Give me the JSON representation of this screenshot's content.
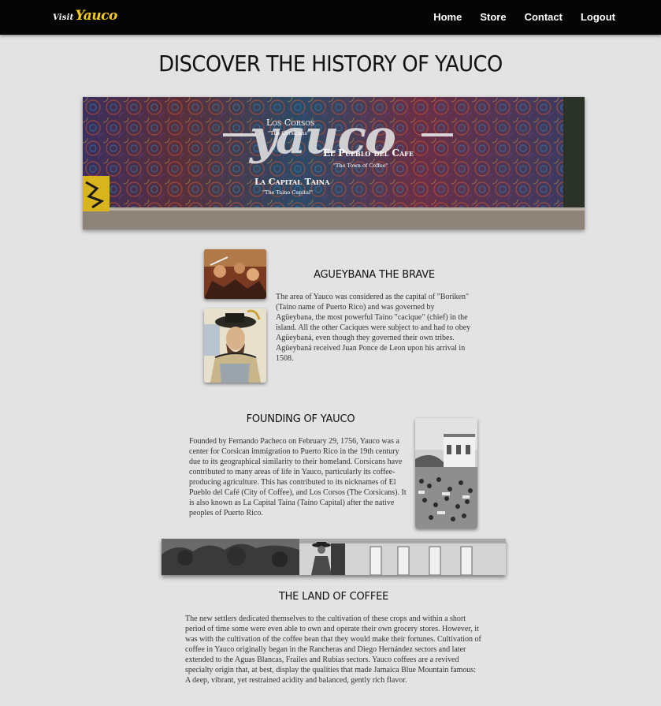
{
  "navbar": {
    "logo_small": "Visit",
    "logo_big": "Yauco",
    "links": [
      "Home",
      "Store",
      "Contact",
      "Logout"
    ]
  },
  "page": {
    "title": "DISCOVER THE HISTORY OF YAUCO"
  },
  "hero": {
    "big_word": "yauco",
    "los_corsos": "Los Corsos",
    "los_corsos_sub": "\"The Corsicans\"",
    "pueblo_cafe": "El Pueblo del Cafe",
    "pueblo_cafe_sub": "\"The Town of Coffee\"",
    "capital_taina": "La Capital Taina",
    "capital_taina_sub": "\"The Taino Capital\""
  },
  "sections": {
    "agueybana": {
      "title": "AGUEYBANA THE BRAVE",
      "body": "The area of Yauco was considered as the capital of \"Boriken\" (Taíno name of Puerto Rico) and was governed by Agüeybana, the most powerful Taíno \"cacique\" (chief) in the island. All the other Caciques were subject to and had to obey Agüeybaná, even though they governed their own tribes. Agüeybaná received Juan Ponce de Leon upon his arrival in 1508."
    },
    "founding": {
      "title": "FOUNDING OF YAUCO",
      "body": "Founded by Fernando Pacheco on February 29, 1756, Yauco was a center for Corsican immigration to Puerto Rico in the 19th century due to its geographical similarity to their homeland. Corsicans have contributed to many areas of life in Yauco, particularly its coffee-producing agriculture. This has contributed to its nicknames of El Pueblo del Café (City of Coffee), and Los Corsos (The Corsicans). It is also known as La Capital Taína (Taíno Capital) after the native peoples of Puerto Rico."
    },
    "coffee": {
      "title": "THE LAND OF COFFEE",
      "body": "The new settlers dedicated themselves to the cultivation of these crops and within a short period of time some were even able to own and operate their own grocery stores. However, it was with the cultivation of the coffee bean that they would make their fortunes. Cultivation of coffee in Yauco originally began in the Rancheras and Diego Hernández sectors and later extended to the Aguas Blancas, Frailes and Rubias sectors. Yauco coffees are a revived specialty origin that, at best, display the qualities that made Jamaica Blue Mountain famous: A deep, vibrant, yet restrained acidity and balanced, gently rich flavor."
    }
  },
  "colors": {
    "navbar_bg": "#050505",
    "logo_accent": "#f2cc12",
    "page_bg": "#e3e3e3"
  }
}
